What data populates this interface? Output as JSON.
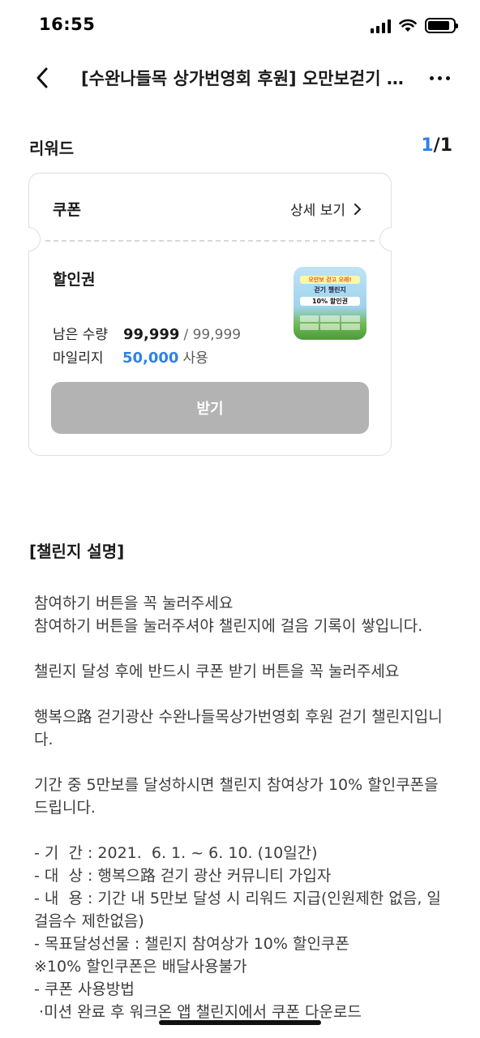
{
  "status_bar": {
    "time": "16:55",
    "battery_level": 0.85
  },
  "nav": {
    "title": "[수완나들목 상가번영회 후원] 오만보걷기 챌린지",
    "back_icon": "chevron-left-icon",
    "more_icon": "more-horizontal-icon"
  },
  "reward": {
    "section_title": "리워드",
    "pager_current": "1",
    "pager_sep": "/",
    "pager_total": "1"
  },
  "card": {
    "type_label": "쿠폰",
    "detail_label": "상세 보기",
    "title": "할인권",
    "remaining_label": "남은 수량",
    "remaining_value": "99,999",
    "remaining_total": "/ 99,999",
    "mileage_label": "마일리지",
    "mileage_value": "50,000",
    "mileage_unit": "사용",
    "button_label": "받기",
    "thumb": {
      "line1": "오만보 걷고 오래!",
      "line2": "걷기 챌린지",
      "line3": "10% 할인권"
    }
  },
  "description": {
    "title": "[챌린지 설명]",
    "paragraphs": [
      "참여하기 버튼을 꼭 눌러주세요\n참여하기 버튼을 눌러주셔야 챌린지에 걸음 기록이 쌓입니다.",
      "챌린지 달성 후에 반드시 쿠폰 받기 버튼을 꼭 눌러주세요",
      "행복으路 걷기광산 수완나들목상가번영회 후원 걷기 챌린지입니다.",
      "기간 중 5만보를 달성하시면 챌린지 참여상가 10% 할인쿠폰을 드립니다.",
      "- 기  간 : 2021.  6. 1. ~ 6. 10. (10일간)\n- 대  상 : 행복으路 걷기 광산 커뮤니티 가입자\n- 내  용 : 기간 내 5만보 달성 시 리워드 지급(인원제한 없음, 일 걸음수 제한없음)\n- 목표달성선물 : 챌린지 참여상가 10% 할인쿠폰\n※10% 할인쿠폰은 배달사용불가\n- 쿠폰 사용방법\n ·미션 완료 후 워크온 앱 챌린지에서 쿠폰 다운로드"
    ]
  }
}
